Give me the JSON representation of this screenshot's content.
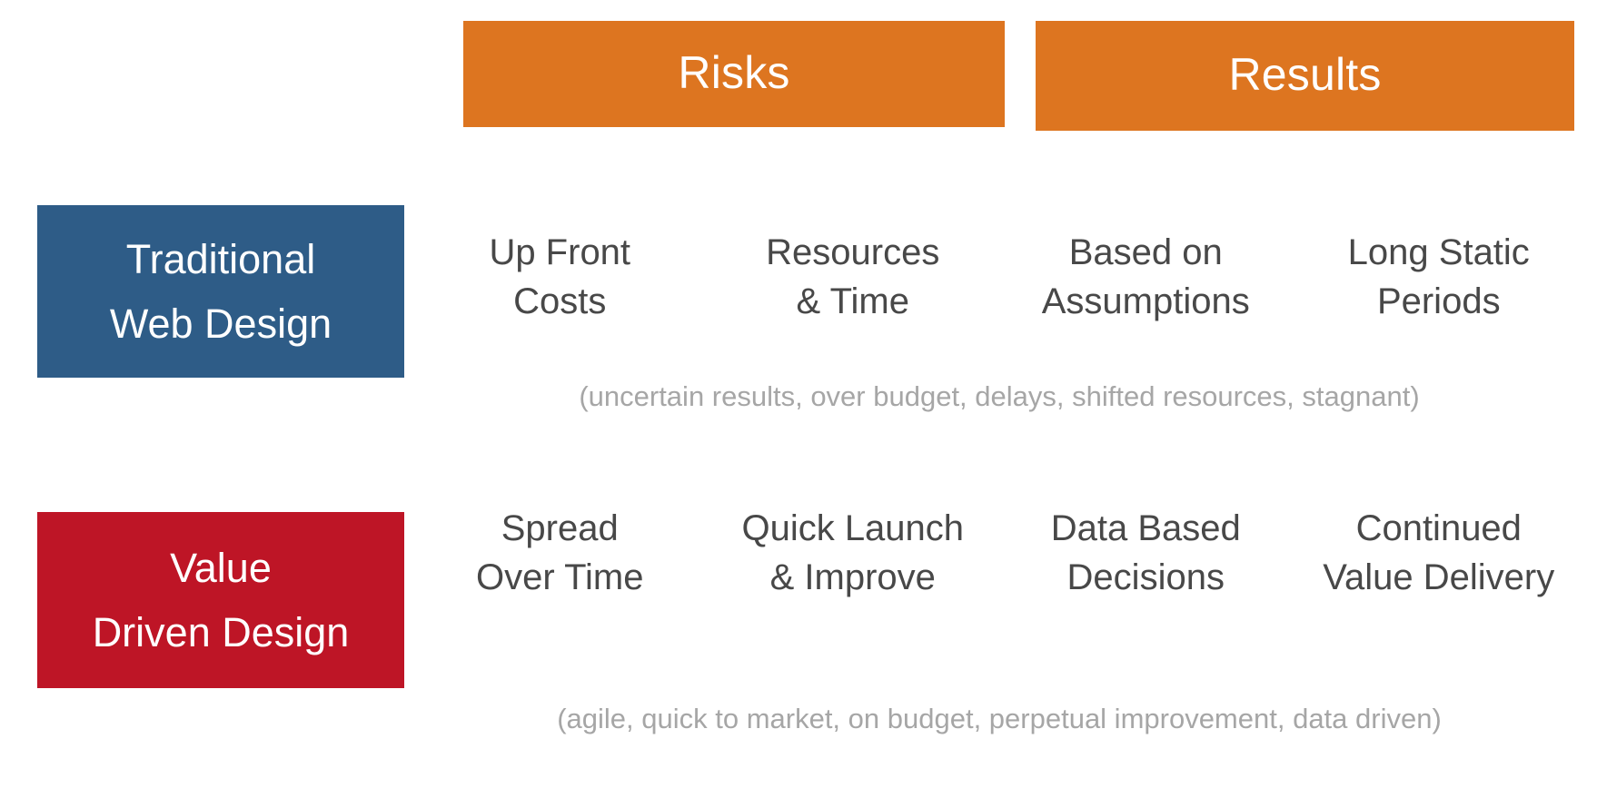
{
  "colors": {
    "header_band": "#DD7520",
    "row_traditional": "#2E5C87",
    "row_value": "#BE1526",
    "body_text": "#484848",
    "note_text": "#A6A6A6",
    "background": "#FFFFFF",
    "header_text": "#FFFFFF"
  },
  "headers": {
    "risks": "Risks",
    "results": "Results"
  },
  "rows": [
    {
      "key": "traditional",
      "label_line1": "Traditional",
      "label_line2": "Web Design",
      "cells": [
        {
          "line1": "Up Front",
          "line2": "Costs"
        },
        {
          "line1": "Resources",
          "line2": "& Time"
        },
        {
          "line1": "Based on",
          "line2": "Assumptions"
        },
        {
          "line1": "Long Static",
          "line2": "Periods"
        }
      ],
      "note": "(uncertain results, over budget, delays, shifted resources, stagnant)"
    },
    {
      "key": "value",
      "label_line1": "Value",
      "label_line2": "Driven Design",
      "cells": [
        {
          "line1": "Spread",
          "line2": "Over Time"
        },
        {
          "line1": "Quick Launch",
          "line2": "& Improve"
        },
        {
          "line1": "Data Based",
          "line2": "Decisions"
        },
        {
          "line1": "Continued",
          "line2": "Value Delivery"
        }
      ],
      "note": "(agile, quick to market, on budget, perpetual improvement, data driven)"
    }
  ]
}
